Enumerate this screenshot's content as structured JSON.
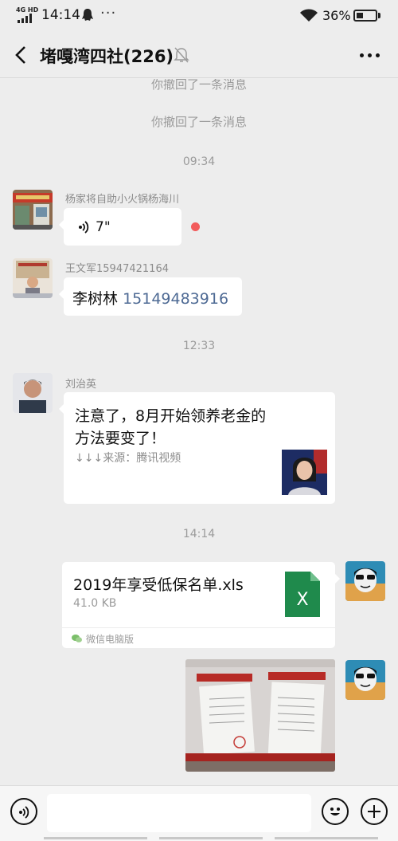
{
  "status_bar": {
    "network": "4G HD",
    "time": "14:14",
    "more_dots": "···",
    "battery_percent": "36%",
    "battery_level": 0.36
  },
  "header": {
    "title": "堵嘎湾四社(226)",
    "back_icon": "chevron-left-icon",
    "mute_icon": "bell-off-icon",
    "more_icon": "more-dots-icon"
  },
  "messages": {
    "system_1": "你撤回了一条消息",
    "system_2": "你撤回了一条消息",
    "time_1": "09:34",
    "voice": {
      "sender": "杨家将自助小火锅杨海川",
      "duration": "7\"",
      "unread_color": "#f25b5b"
    },
    "contact": {
      "sender": "王文军15947421164",
      "name": "李树林",
      "phone": "15149483916"
    },
    "time_2": "12:33",
    "article": {
      "sender": "刘治英",
      "title": "注意了，8月开始领养老金的方法要变了！",
      "source": "↓↓↓来源：腾讯视频"
    },
    "time_3": "14:14",
    "file": {
      "name": "2019年享受低保名单.xls",
      "size": "41.0 KB",
      "footer": "微信电脑版",
      "icon_letter": "X",
      "icon_color": "#1f8a4c"
    }
  },
  "input_bar": {
    "placeholder": ""
  },
  "colors": {
    "background": "#ededed",
    "link": "#4e6a94"
  }
}
